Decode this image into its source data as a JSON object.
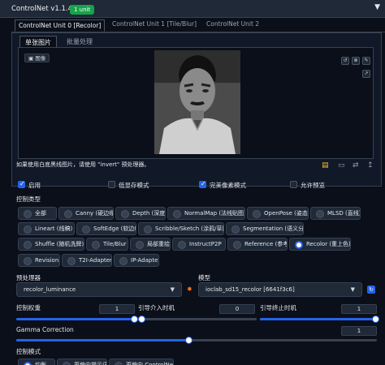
{
  "header": {
    "title": "ControlNet v1.1.410",
    "badge": "1 unit",
    "collapse_icon": "triangle-down-icon"
  },
  "unit_tabs": [
    {
      "label": "ControlNet Unit 0 [Recolor]",
      "active": true
    },
    {
      "label": "ControlNet Unit 1 [Tile/Blur]",
      "active": false
    },
    {
      "label": "ControlNet Unit 2",
      "active": false
    }
  ],
  "image_tabs": [
    {
      "label": "单张图片",
      "active": true
    },
    {
      "label": "批量处理",
      "active": false
    }
  ],
  "image_panel": {
    "label": "图像",
    "label_icon": "image-icon",
    "tools": [
      "undo-icon",
      "clear-icon",
      "edit-icon"
    ],
    "resize_icon": "resize-arrow-icon",
    "photo_icon": "portrait-photo-icon"
  },
  "hint": "如果使用白底黑线图片，请使用 \"invert\" 预处理器。",
  "hint_tools": [
    "new-canvas-icon",
    "camera-icon",
    "swap-icon",
    "send-dimensions-icon"
  ],
  "checkboxes": [
    {
      "label": "启用",
      "checked": true
    },
    {
      "label": "低显存模式",
      "checked": false
    },
    {
      "label": "完美像素模式",
      "checked": true
    },
    {
      "label": "允许预览",
      "checked": false
    }
  ],
  "control_type": {
    "label": "控制类型",
    "options": [
      "全部",
      "Canny (硬边缘)",
      "Depth (深度)",
      "NormalMap (法线贴图)",
      "OpenPose (姿态)",
      "MLSD (直线)",
      "Lineart (线稿)",
      "SoftEdge (软边缘)",
      "Scribble/Sketch (涂鸦/草图)",
      "Segmentation (语义分割)",
      "Shuffle (随机洗牌)",
      "Tile/Blur",
      "局部重绘",
      "InstructP2P",
      "Reference (参考)",
      "Recolor (重上色)",
      "Revision",
      "T2I-Adapter",
      "IP-Adapter"
    ],
    "selected": "Recolor (重上色)"
  },
  "preprocessor": {
    "label": "预处理器",
    "value": "recolor_luminance",
    "run_icon": "explosion-icon"
  },
  "model": {
    "label": "模型",
    "value": "ioclab_sd15_recolor [6641f3c6]",
    "refresh_icon": "refresh-icon"
  },
  "sliders": {
    "weight": {
      "label": "控制权重",
      "value": "1",
      "fraction": 1.0
    },
    "start": {
      "label": "引导介入时机",
      "value": "0",
      "fraction": 0.0
    },
    "end": {
      "label": "引导终止时机",
      "value": "1",
      "fraction": 1.0
    },
    "gamma": {
      "label": "Gamma Correction",
      "value": "1",
      "fraction": 0.5
    }
  },
  "control_mode": {
    "label": "控制模式",
    "options": [
      "均衡",
      "更偏向提示词",
      "更偏向 ControlNet"
    ],
    "selected": "均衡"
  },
  "colors": {
    "accent": "#2563eb",
    "badge": "#16a34a",
    "background": "#0b0f19",
    "panel": "#1f2937"
  }
}
